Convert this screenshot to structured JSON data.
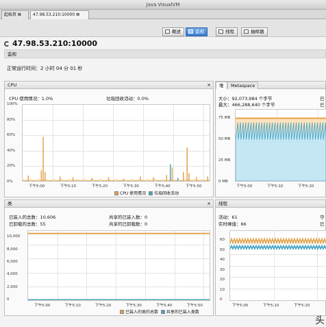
{
  "window": {
    "title": "Java VisualVM"
  },
  "doc_tabs": [
    {
      "label": "起始页 ⊠"
    },
    {
      "label": "47.98.53.210:10000 ⊠"
    }
  ],
  "view_tabs": [
    {
      "label": "概述"
    },
    {
      "label": "监视"
    },
    {
      "label": "线程"
    },
    {
      "label": "抽样器"
    }
  ],
  "host": "47.98.53.210:10000",
  "monitor_label": "监视",
  "uptime": "正常运行时间：2 小时 04 分 01 秒",
  "cpu": {
    "title": "CPU",
    "close": "×",
    "usage": "CPU 使用情况：1.0%",
    "gc": "垃圾回收活动：0.0%",
    "legend": [
      "CPU 使用情况",
      "垃圾回收活动"
    ],
    "colors": {
      "cpu": "#e2a24a",
      "gc": "#4aa6b5"
    }
  },
  "heap": {
    "tabs": [
      "堆",
      "Metaspace"
    ],
    "size": "大小：92,073,984 个字节",
    "max": "最大：466,288,640 个字节",
    "right_label_1": "已",
    "right_label_2": "已"
  },
  "classes": {
    "title": "类",
    "close": "×",
    "loaded_total": "已装入的总数：10,606",
    "unloaded_total": "已卸载的总数：55",
    "shared_loaded": "共享的已装入数：0",
    "shared_unloaded": "共享的已卸载数：0",
    "legend": [
      "已装入的类的总数",
      "共享的已装入类数"
    ],
    "colors": {
      "loaded": "#e2a24a",
      "shared": "#4aa6b5"
    }
  },
  "threads": {
    "title": "线程",
    "live": "活动：61",
    "peak": "实时峰值：66",
    "right_label_1": "守",
    "right_label_2": "已"
  },
  "time_ticks": [
    "下午5:00",
    "下午5:10",
    "下午5:20",
    "下午5:30",
    "下午5:40",
    "下午5:50"
  ],
  "watermark": "头",
  "chart_data": [
    {
      "type": "line",
      "title": "CPU",
      "y_ticks": [
        "100%",
        "80%",
        "60%",
        "40%",
        "20%",
        "0%"
      ],
      "ylim": [
        0,
        100
      ],
      "series": [
        {
          "name": "CPU 使用情况",
          "peaks": [
            [
              0.03,
              7
            ],
            [
              0.1,
              14
            ],
            [
              0.11,
              58
            ],
            [
              0.12,
              12
            ],
            [
              0.2,
              6
            ],
            [
              0.27,
              5
            ],
            [
              0.37,
              4
            ],
            [
              0.46,
              5
            ],
            [
              0.54,
              3
            ],
            [
              0.63,
              6
            ],
            [
              0.7,
              5
            ],
            [
              0.77,
              8
            ],
            [
              0.8,
              18
            ],
            [
              0.86,
              12
            ],
            [
              0.88,
              44
            ],
            [
              0.89,
              10
            ],
            [
              0.93,
              5
            ],
            [
              0.99,
              6
            ]
          ]
        },
        {
          "name": "垃圾回收活动",
          "peaks": [
            [
              0.79,
              22
            ],
            [
              0.83,
              4
            ]
          ]
        }
      ]
    },
    {
      "type": "area",
      "title": "堆",
      "y_ticks": [
        "75 MB",
        "50 MB",
        "25 MB",
        "0 MB"
      ],
      "ylim": [
        0,
        100
      ],
      "series": [
        {
          "name": "大小",
          "value": 88
        },
        {
          "name": "已使用",
          "min": 58,
          "max": 82
        }
      ]
    },
    {
      "type": "line",
      "title": "类",
      "y_ticks": [
        "10,000",
        "8,000",
        "6,000",
        "4,000",
        "2,000",
        "0"
      ],
      "ylim": [
        0,
        11000
      ],
      "series": [
        {
          "name": "已装入的类的总数",
          "value": 10606
        },
        {
          "name": "共享的已装入类数",
          "value": 0
        }
      ]
    },
    {
      "type": "line",
      "title": "线程",
      "y_ticks": [
        "60",
        "50",
        "40",
        "30",
        "20",
        "10",
        "0"
      ],
      "ylim": [
        0,
        70
      ],
      "series": [
        {
          "name": "活动",
          "min": 58,
          "max": 62
        },
        {
          "name": "守护",
          "min": 52,
          "max": 55
        }
      ]
    }
  ]
}
